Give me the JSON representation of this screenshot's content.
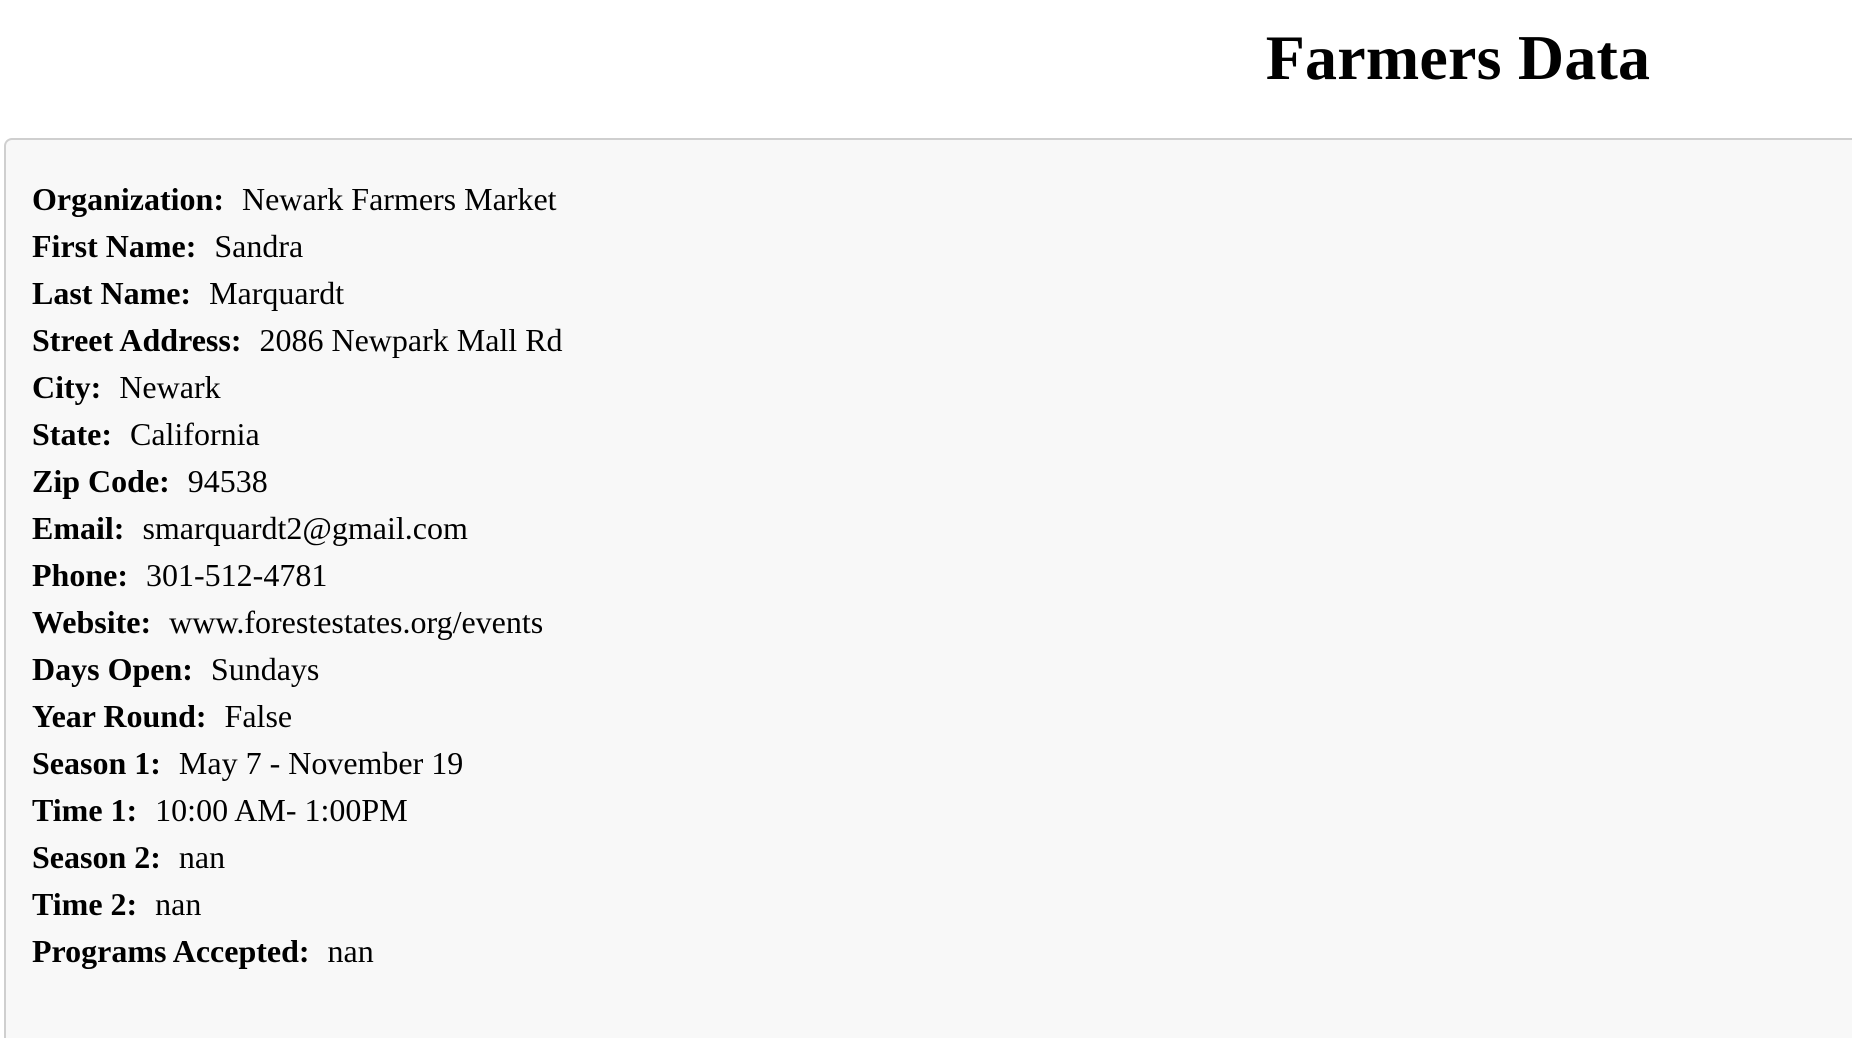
{
  "page": {
    "title": "Farmers Data"
  },
  "record": {
    "fields": [
      {
        "label": "Organization:",
        "value": "Newark Farmers Market"
      },
      {
        "label": "First Name:",
        "value": "Sandra"
      },
      {
        "label": "Last Name:",
        "value": "Marquardt"
      },
      {
        "label": "Street Address:",
        "value": "2086 Newpark Mall Rd"
      },
      {
        "label": "City:",
        "value": "Newark"
      },
      {
        "label": "State:",
        "value": "California"
      },
      {
        "label": "Zip Code:",
        "value": "94538"
      },
      {
        "label": "Email:",
        "value": "smarquardt2@gmail.com"
      },
      {
        "label": "Phone:",
        "value": "301-512-4781"
      },
      {
        "label": "Website:",
        "value": "www.forestestates.org/events"
      },
      {
        "label": "Days Open:",
        "value": "Sundays"
      },
      {
        "label": "Year Round:",
        "value": "False"
      },
      {
        "label": "Season 1:",
        "value": "May 7 - November 19"
      },
      {
        "label": "Time 1:",
        "value": "10:00 AM- 1:00PM"
      },
      {
        "label": "Season 2:",
        "value": "nan"
      },
      {
        "label": "Time 2:",
        "value": "nan"
      },
      {
        "label": "Programs Accepted:",
        "value": "nan"
      }
    ]
  },
  "colors": {
    "page_background": "#ffffff",
    "card_background": "#f8f8f8",
    "card_border": "#cfcfcf",
    "text": "#000000"
  }
}
